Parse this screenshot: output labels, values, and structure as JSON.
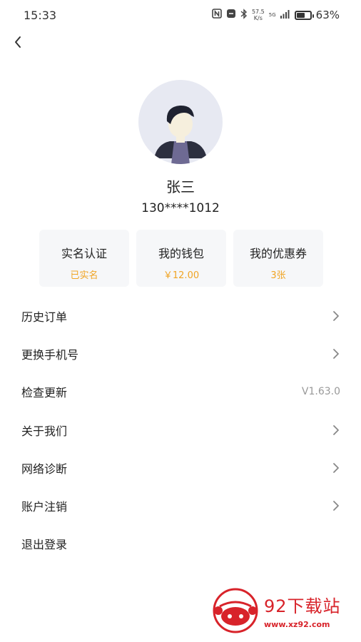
{
  "status_bar": {
    "time": "15:33",
    "net_speed_value": "57.5",
    "net_speed_unit": "K/s",
    "signal_label": "5G",
    "battery_percent": "63%",
    "battery_level": 0.63,
    "icons": [
      "nfc-icon",
      "vibrate-icon",
      "bluetooth-icon",
      "signal-icon",
      "battery-icon"
    ]
  },
  "nav": {
    "back_icon": "chevron-left-icon"
  },
  "profile": {
    "name": "张三",
    "phone": "130****1012"
  },
  "cards": [
    {
      "title": "实名认证",
      "value": "已实名"
    },
    {
      "title": "我的钱包",
      "value": "￥12.00"
    },
    {
      "title": "我的优惠券",
      "value": "3张"
    }
  ],
  "menu": [
    {
      "label": "历史订单",
      "value": "",
      "has_arrow": true
    },
    {
      "label": "更换手机号",
      "value": "",
      "has_arrow": true
    },
    {
      "label": "检查更新",
      "value": "V1.63.0",
      "has_arrow": false
    },
    {
      "label": "关于我们",
      "value": "",
      "has_arrow": true
    },
    {
      "label": "网络诊断",
      "value": "",
      "has_arrow": true
    },
    {
      "label": "账户注销",
      "value": "",
      "has_arrow": true
    },
    {
      "label": "退出登录",
      "value": "",
      "has_arrow": false
    }
  ],
  "watermark": {
    "title": "92下载站",
    "url": "www.xz92.com"
  },
  "colors": {
    "accent": "#f0a424",
    "card_bg": "#f6f7f9",
    "avatar_bg": "#e7e9f2",
    "watermark_red": "#d8232a"
  }
}
